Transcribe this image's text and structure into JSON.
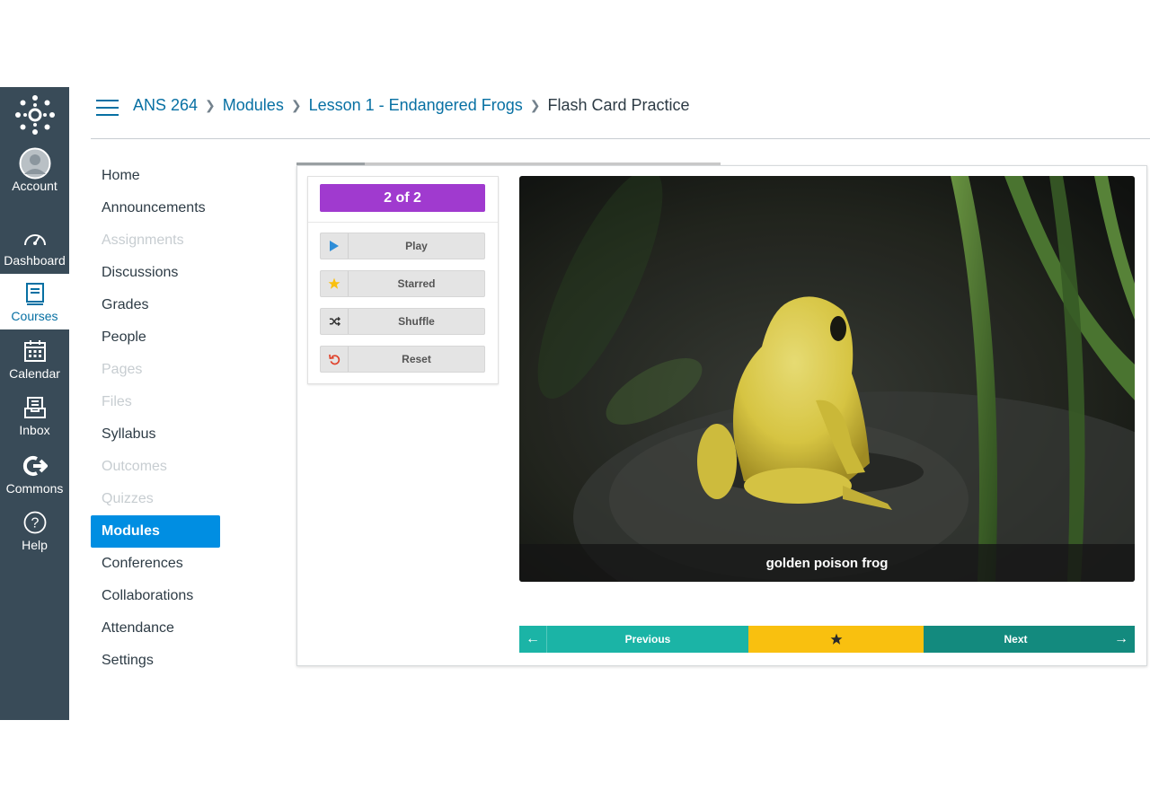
{
  "global_nav": {
    "items": [
      {
        "label": "Account",
        "icon": "account-icon"
      },
      {
        "label": "Dashboard",
        "icon": "dashboard-icon"
      },
      {
        "label": "Courses",
        "icon": "courses-icon"
      },
      {
        "label": "Calendar",
        "icon": "calendar-icon"
      },
      {
        "label": "Inbox",
        "icon": "inbox-icon"
      },
      {
        "label": "Commons",
        "icon": "commons-icon"
      },
      {
        "label": "Help",
        "icon": "help-icon"
      }
    ],
    "active": "Courses"
  },
  "breadcrumb": {
    "items": [
      "ANS 264",
      "Modules",
      "Lesson 1 - Endangered Frogs"
    ],
    "current": "Flash Card Practice"
  },
  "course_nav": {
    "items": [
      {
        "label": "Home",
        "state": "enabled"
      },
      {
        "label": "Announcements",
        "state": "enabled"
      },
      {
        "label": "Assignments",
        "state": "disabled"
      },
      {
        "label": "Discussions",
        "state": "enabled"
      },
      {
        "label": "Grades",
        "state": "enabled"
      },
      {
        "label": "People",
        "state": "enabled"
      },
      {
        "label": "Pages",
        "state": "disabled"
      },
      {
        "label": "Files",
        "state": "disabled"
      },
      {
        "label": "Syllabus",
        "state": "enabled"
      },
      {
        "label": "Outcomes",
        "state": "disabled"
      },
      {
        "label": "Quizzes",
        "state": "disabled"
      },
      {
        "label": "Modules",
        "state": "active"
      },
      {
        "label": "Conferences",
        "state": "enabled"
      },
      {
        "label": "Collaborations",
        "state": "enabled"
      },
      {
        "label": "Attendance",
        "state": "enabled"
      },
      {
        "label": "Settings",
        "state": "enabled"
      }
    ]
  },
  "flashcards": {
    "counter": "2 of 2",
    "progress_fraction": 0.16,
    "controls": [
      {
        "label": "Play",
        "icon": "play-icon"
      },
      {
        "label": "Starred",
        "icon": "star-icon"
      },
      {
        "label": "Shuffle",
        "icon": "shuffle-icon"
      },
      {
        "label": "Reset",
        "icon": "reset-icon"
      }
    ],
    "card_caption": "golden poison frog",
    "prev_label": "Previous",
    "next_label": "Next"
  },
  "colors": {
    "nav_bg": "#394B58",
    "link": "#0770A3",
    "active_nav": "#008EE2",
    "counter_bg": "#A03ACF",
    "prev_bg": "#1BB4A6",
    "star_bg": "#F9C00F",
    "next_bg": "#138A7E"
  }
}
